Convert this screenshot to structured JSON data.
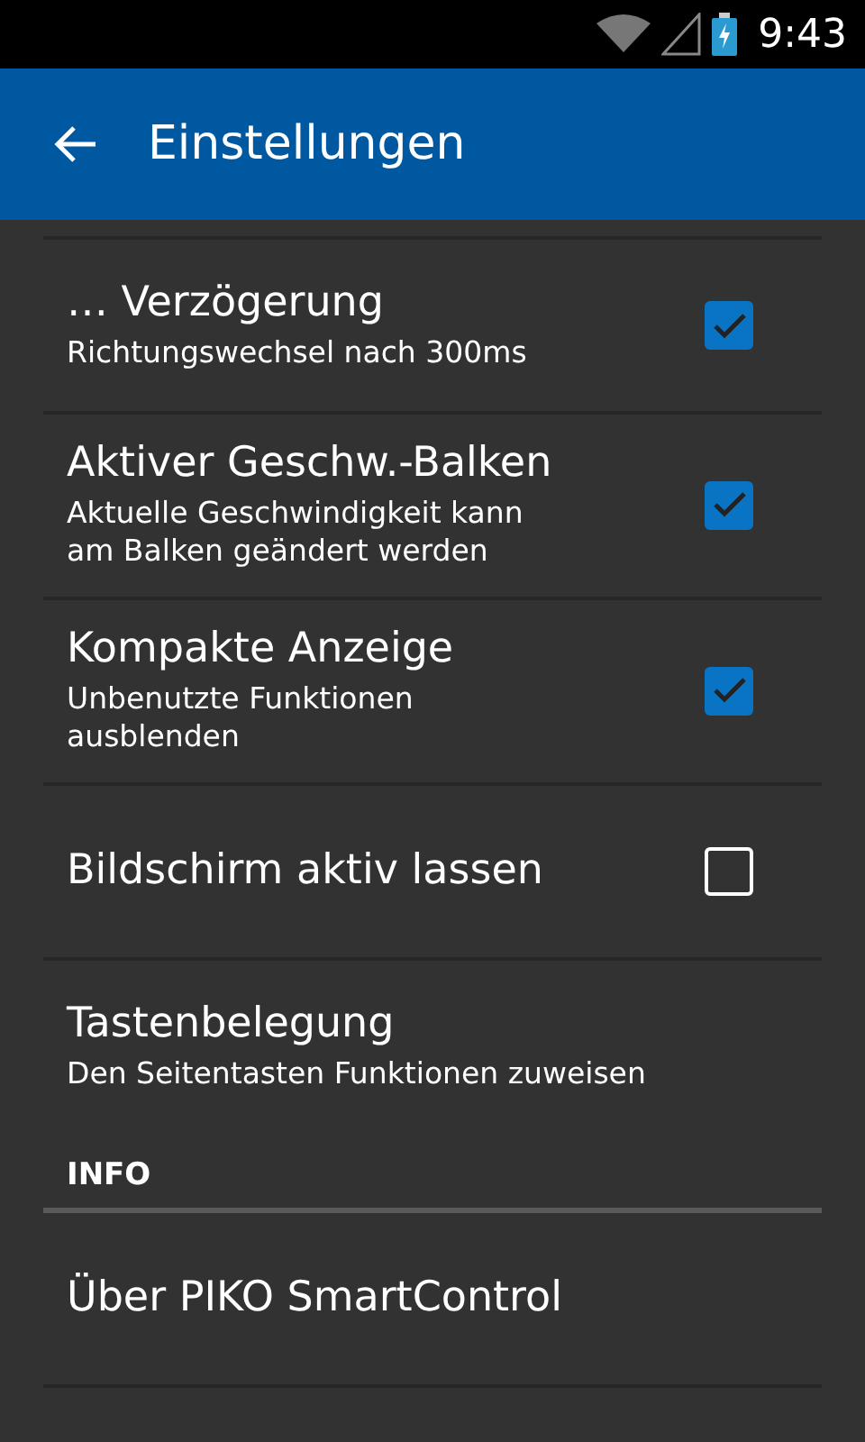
{
  "status_bar": {
    "time": "9:43"
  },
  "app_bar": {
    "title": "Einstellungen"
  },
  "items": [
    {
      "kind": "checkbox",
      "title": "… Verzögerung",
      "summary": "Richtungswechsel nach 300ms",
      "checked": true
    },
    {
      "kind": "checkbox",
      "title": "Aktiver Geschw.-Balken",
      "summary": "Aktuelle Geschwindigkeit kann\nam Balken geändert werden",
      "checked": true
    },
    {
      "kind": "checkbox",
      "title": "Kompakte Anzeige",
      "summary": "Unbenutzte Funktionen\nausblenden",
      "checked": true
    },
    {
      "kind": "checkbox",
      "title": "Bildschirm aktiv lassen",
      "checked": false
    },
    {
      "kind": "plain",
      "title": "Tastenbelegung",
      "summary": "Den Seitentasten Funktionen zuweisen"
    },
    {
      "kind": "header",
      "title": "INFO"
    },
    {
      "kind": "plain",
      "title": "Über PIKO SmartControl"
    }
  ]
}
